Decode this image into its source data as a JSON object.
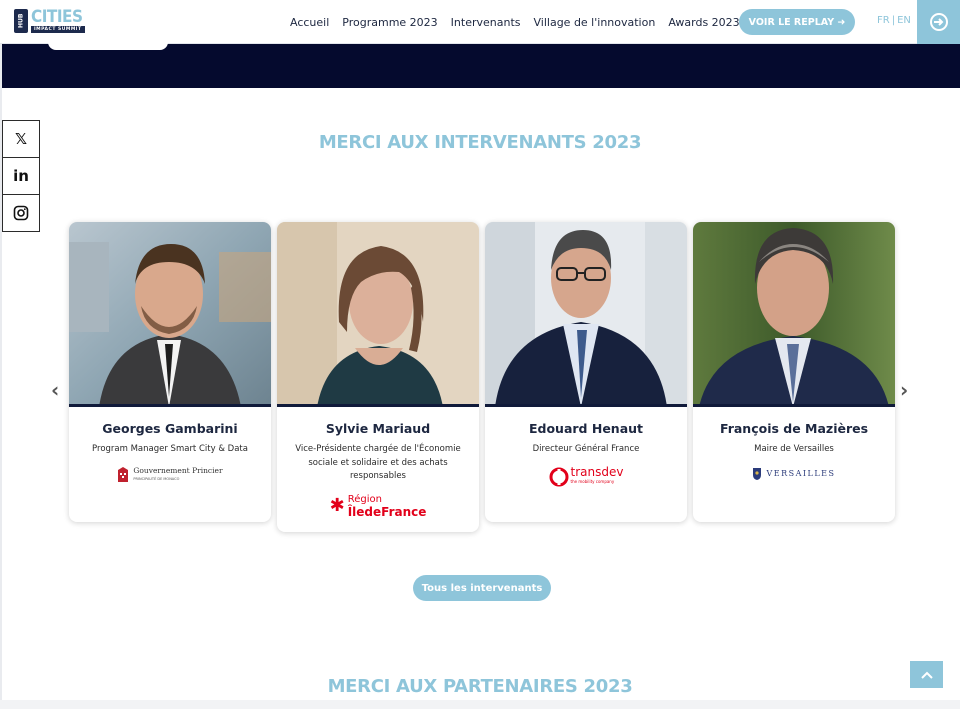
{
  "header": {
    "logo": {
      "hub": "HUB",
      "cities": "CITIES",
      "tagline": "IMPACT SUMMIT"
    },
    "nav": [
      "Accueil",
      "Programme 2023",
      "Intervenants",
      "Village de l'innovation",
      "Awards 2023"
    ],
    "replay_label": "VOIR LE REPLAY ➜",
    "lang_fr": "FR",
    "lang_sep": "|",
    "lang_en": "EN",
    "login_icon": "login-arrow-icon"
  },
  "social": [
    {
      "name": "x-twitter-icon",
      "glyph": "𝕏"
    },
    {
      "name": "linkedin-icon",
      "glyph": "in"
    },
    {
      "name": "instagram-icon",
      "glyph": "◎"
    }
  ],
  "speakers_section": {
    "title": "MERCI AUX INTERVENANTS 2023",
    "prev_arrow": "‹",
    "next_arrow": "›",
    "speakers": [
      {
        "name": "Georges Gambarini",
        "role": "Program Manager Smart City & Data",
        "org": "Gouvernement Princier",
        "org_sub": "PRINCIPAUTÉ DE MONACO"
      },
      {
        "name": "Sylvie Mariaud",
        "role": "Vice-Présidente chargée de l'Économie sociale et solidaire et des achats responsables",
        "org": "Région",
        "org_sub": "ÎledeFrance"
      },
      {
        "name": "Edouard Henaut",
        "role": "Directeur Général France",
        "org": "transdev",
        "org_sub": "the mobility company"
      },
      {
        "name": "François de Mazières",
        "role": "Maire de Versailles",
        "org": "VERSAILLES",
        "org_sub": ""
      }
    ],
    "cta_label": "Tous les intervenants"
  },
  "partners_section": {
    "title": "MERCI AUX PARTENAIRES 2023"
  },
  "colors": {
    "accent": "#8ec5da",
    "navy": "#050a2e",
    "text": "#1d2740"
  }
}
